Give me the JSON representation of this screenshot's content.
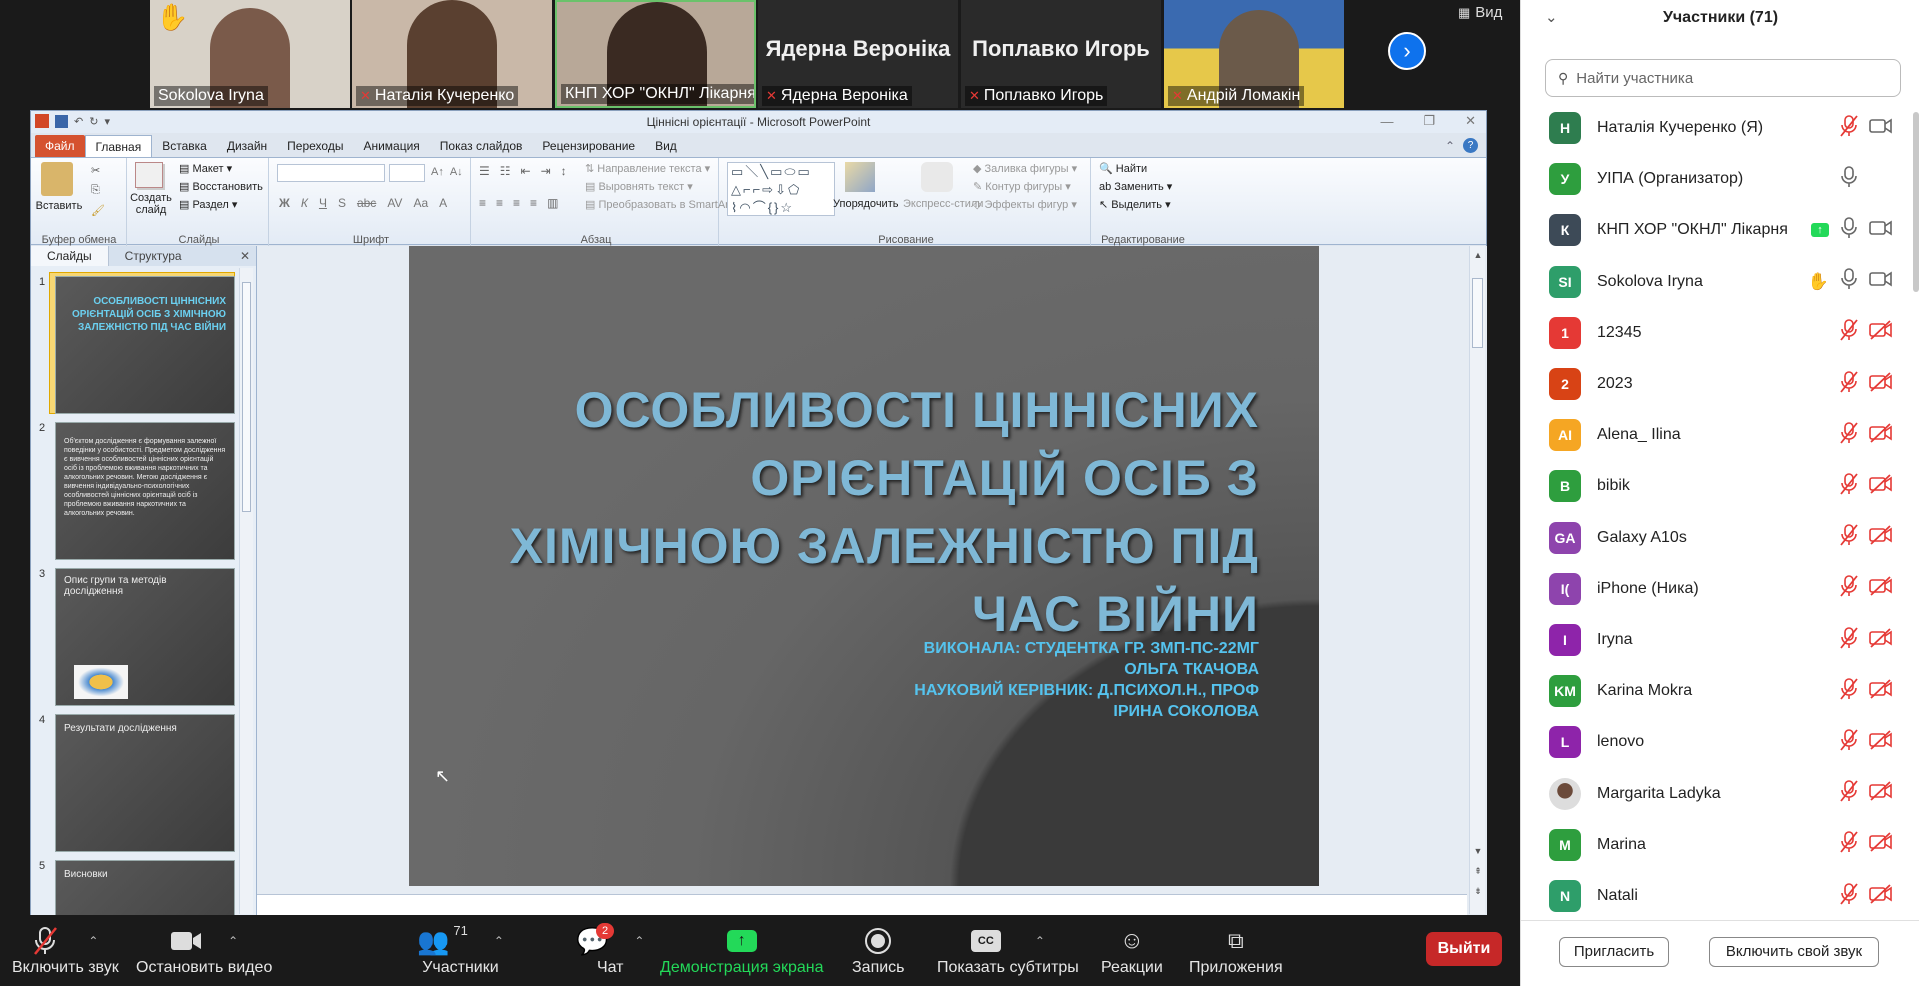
{
  "video_strip": {
    "tiles": [
      {
        "name": "Sokolova Iryna",
        "muted": false
      },
      {
        "name": "Наталія Кучеренко",
        "muted": true
      },
      {
        "name": "КНП ХОР \"ОКНЛ\" Лікарня",
        "muted": false
      },
      {
        "name": "Ядерна Вероніка",
        "muted": true,
        "big": "Ядерна Вероніка"
      },
      {
        "name": "Поплавко Игорь",
        "muted": true,
        "big": "Поплавко Игорь"
      },
      {
        "name": "Андрій Ломакін",
        "muted": true
      }
    ],
    "view_label": "Вид",
    "hand_icon": "raised-hand-icon"
  },
  "ppt": {
    "title": "Ціннісні орієнтації - Microsoft PowerPoint",
    "tabs": [
      "Файл",
      "Главная",
      "Вставка",
      "Дизайн",
      "Переходы",
      "Анимация",
      "Показ слайдов",
      "Рецензирование",
      "Вид"
    ],
    "active_tab": "Главная",
    "groups": {
      "clipboard": "Буфер обмена",
      "slides": "Слайды",
      "font": "Шрифт",
      "paragraph": "Абзац",
      "drawing": "Рисование",
      "editing": "Редактирование"
    },
    "buttons": {
      "paste": "Вставить",
      "create_slide": "Создать слайд",
      "layout": "Макет",
      "reset": "Восстановить",
      "section": "Раздел",
      "text_direction": "Направление текста",
      "align_text": "Выровнять текст",
      "smartart": "Преобразовать в SmartArt",
      "arrange": "Упорядочить",
      "quick_styles": "Экспресс-стили",
      "shape_fill": "Заливка фигуры",
      "shape_outline": "Контур фигуры",
      "shape_effects": "Эффекты фигур",
      "find": "Найти",
      "replace": "Заменить",
      "select": "Выделить"
    },
    "panel_tabs": [
      "Слайды",
      "Структура"
    ],
    "thumbnails": [
      {
        "num": "1",
        "title": "ОСОБЛИВОСТІ ЦІННІСНИХ ОРІЄНТАЦІЙ ОСІБ З ХІМІЧНОЮ ЗАЛЕЖНІСТЮ ПІД ЧАС ВІЙНИ"
      },
      {
        "num": "2",
        "title": "Об'єктом дослідження є формування залежної поведінки у особистості. Предметом дослідження є вивчення особливостей ціннісних орієнтацій осіб із проблемою вживання наркотичних та алкогольних речовин. Метою дослідження є вивчення індивідуально-психологічних особливостей ціннісних орієнтацій осіб із проблемою вживання наркотичних та алкогольних речовин."
      },
      {
        "num": "3",
        "title": "Опис групи та методів дослідження"
      },
      {
        "num": "4",
        "title": "Результати дослідження"
      },
      {
        "num": "5",
        "title": "Висновки"
      }
    ],
    "slide": {
      "title": "ОСОБЛИВОСТІ ЦІННІСНИХ ОРІЄНТАЦІЙ ОСІБ З ХІМІЧНОЮ ЗАЛЕЖНІСТЮ ПІД ЧАС ВІЙНИ",
      "sub1": "ВИКОНАЛА: СТУДЕНТКА ГР. ЗМП-ПС-22МГ",
      "sub2": "ОЛЬГА ТКАЧОВА",
      "sub3": "НАУКОВИЙ КЕРІВНИК: Д.ПСИХОЛ.Н., ПРОФ",
      "sub4": "ІРИНА СОКОЛОВА"
    }
  },
  "panel": {
    "header": "Участники (71)",
    "search_placeholder": "Найти участника",
    "participants": [
      {
        "initials": "Н",
        "name": "Наталія Кучеренко (Я)",
        "color": "#2e7d4f",
        "mic": "off",
        "cam": "on-gray"
      },
      {
        "initials": "У",
        "name": "УІПА (Организатор)",
        "color": "#2e9e3e",
        "mic": "on",
        "cam": "none"
      },
      {
        "initials": "К",
        "name": "КНП ХОР \"ОКНЛ\" Лікарня",
        "color": "#3d4a57",
        "mic": "on",
        "cam": "on-gray",
        "share": true
      },
      {
        "initials": "SI",
        "name": "Sokolova Iryna",
        "color": "#2e9e6a",
        "mic": "on",
        "cam": "on-gray",
        "hand": true
      },
      {
        "initials": "1",
        "name": "12345",
        "color": "#e53935",
        "mic": "off",
        "cam": "off"
      },
      {
        "initials": "2",
        "name": "2023",
        "color": "#d84315",
        "mic": "off",
        "cam": "off"
      },
      {
        "initials": "AI",
        "name": "Alena_ Ilina",
        "color": "#f5a623",
        "mic": "off",
        "cam": "off"
      },
      {
        "initials": "B",
        "name": "bibik",
        "color": "#2e9e3e",
        "mic": "off",
        "cam": "off"
      },
      {
        "initials": "GA",
        "name": "Galaxy A10s",
        "color": "#8e44ad",
        "mic": "off",
        "cam": "off"
      },
      {
        "initials": "I(",
        "name": "iPhone (Ника)",
        "color": "#8e44ad",
        "mic": "off",
        "cam": "off"
      },
      {
        "initials": "I",
        "name": "Iryna",
        "color": "#8e24aa",
        "mic": "off",
        "cam": "off"
      },
      {
        "initials": "KM",
        "name": "Karina Mokra",
        "color": "#2e9e3e",
        "mic": "off",
        "cam": "off"
      },
      {
        "initials": "L",
        "name": "lenovo",
        "color": "#8e24aa",
        "mic": "off",
        "cam": "off"
      },
      {
        "initials": "",
        "name": "Margarita Ladyka",
        "color": "#9e9e9e",
        "mic": "off",
        "cam": "off",
        "photo": true
      },
      {
        "initials": "M",
        "name": "Marina",
        "color": "#2e9e3e",
        "mic": "off",
        "cam": "off"
      },
      {
        "initials": "N",
        "name": "Natali",
        "color": "#2e9e6a",
        "mic": "off",
        "cam": "off"
      }
    ],
    "invite_label": "Пригласить",
    "unmute_self_label": "Включить свой звук"
  },
  "toolbar": {
    "unmute": "Включить звук",
    "stop_video": "Остановить видео",
    "participants": "Участники",
    "participants_count": "71",
    "chat": "Чат",
    "chat_badge": "2",
    "share": "Демонстрация экрана",
    "record": "Запись",
    "captions": "Показать субтитры",
    "captions_icon_text": "CC",
    "reactions": "Реакции",
    "apps": "Приложения",
    "leave": "Выйти"
  },
  "colors": {
    "share_green": "#23d959",
    "leave_red": "#c62828",
    "slide_title": "#7fb8d6"
  }
}
